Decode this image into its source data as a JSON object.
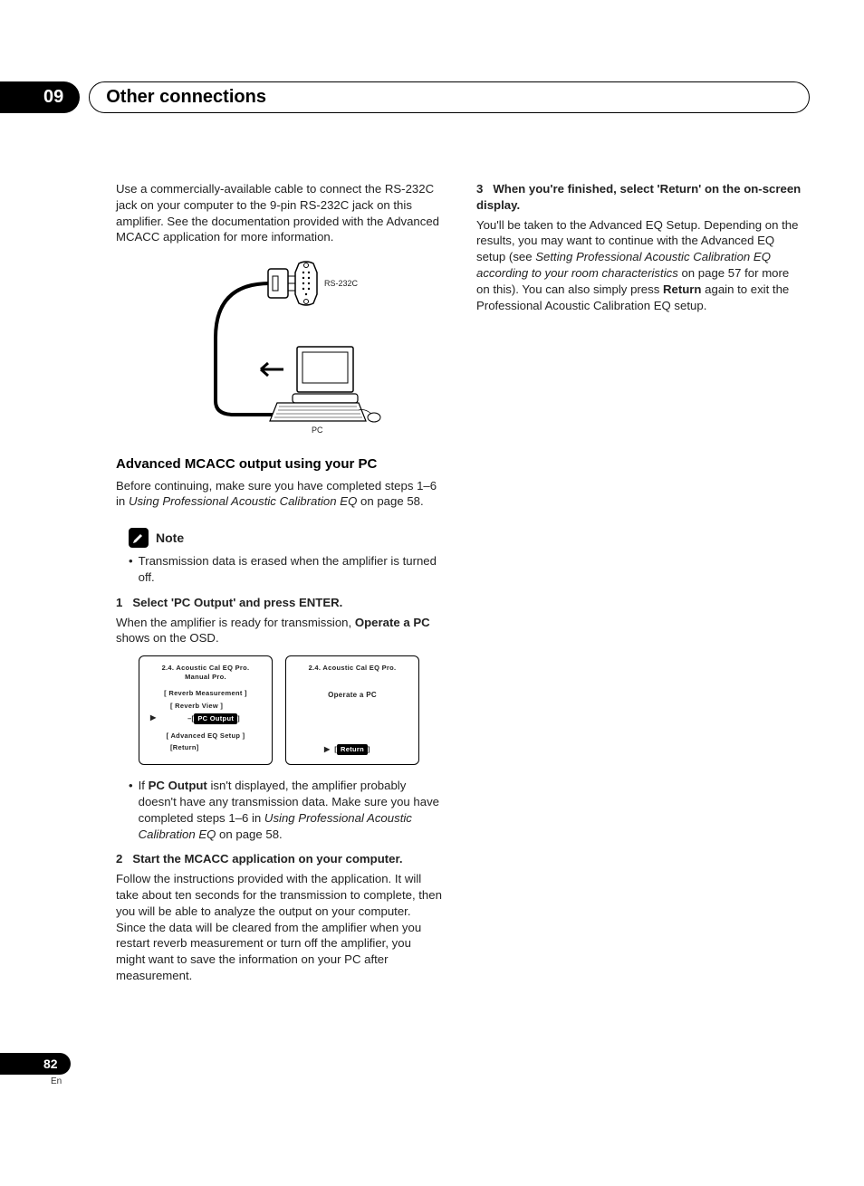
{
  "header": {
    "chapter_num": "09",
    "chapter_title": "Other connections"
  },
  "left": {
    "intro": "Use a commercially-available cable to connect the RS-232C jack on your computer to the 9-pin RS-232C jack on this amplifier. See the documentation provided with the Advanced MCACC application for more information.",
    "diagram": {
      "port_label": "RS-232C",
      "pc_label": "PC"
    },
    "subheading": "Advanced MCACC output using your PC",
    "sub_intro_a": "Before continuing, make sure you have completed steps 1–6 in ",
    "sub_intro_italic": "Using Professional Acoustic Calibration EQ",
    "sub_intro_b": " on page 58.",
    "note_label": "Note",
    "note_bullet": "Transmission data is erased when the amplifier is turned off.",
    "step1_num": "1",
    "step1_title": "Select 'PC Output' and press ENTER.",
    "step1_body_a": "When the amplifier is ready for transmission, ",
    "step1_body_bold": "Operate a PC",
    "step1_body_b": " shows on the OSD.",
    "osd1": {
      "title1": "2.4. Acoustic  Cal  EQ  Pro.",
      "title2": "Manual  Pro.",
      "l1": "[ Reverb  Measurement ]",
      "l2": "[ Reverb  View ]",
      "l3_prefix": "–[",
      "l3_sel": " PC  Output ",
      "l3_suffix": "]",
      "l4": "[ Advanced  EQ  Setup ]",
      "l5": "[Return]"
    },
    "osd2": {
      "title": "2.4. Acoustic  Cal  EQ  Pro.",
      "body": "Operate a PC",
      "ret_prefix": "[",
      "ret_sel": "Return",
      "ret_suffix": "]"
    },
    "after_osd_bullet_a": "If ",
    "after_osd_bullet_bold": "PC Output",
    "after_osd_bullet_b": " isn't displayed, the amplifier probably doesn't have any transmission data. Make sure you have completed steps 1–6 in ",
    "after_osd_bullet_italic": "Using Professional Acoustic Calibration EQ",
    "after_osd_bullet_c": " on page 58.",
    "step2_num": "2",
    "step2_title": "Start the MCACC application on your computer.",
    "step2_body": "Follow the instructions provided with the application. It will take about ten seconds for the transmission to complete, then you will be able to analyze the output on your computer. Since the data will be cleared from the amplifier when you restart reverb measurement or turn off the amplifier, you might want to save the information on your PC after measurement."
  },
  "right": {
    "step3_num": "3",
    "step3_title": "When you're finished, select 'Return' on the on-screen display.",
    "step3_body_a": "You'll be taken to the Advanced EQ Setup. Depending on the results, you may want to continue with the Advanced EQ setup (see ",
    "step3_body_italic": "Setting Professional Acoustic Calibration EQ according to your room characteristics",
    "step3_body_b": " on page 57 for more on this). You can also simply press ",
    "step3_body_bold": "Return",
    "step3_body_c": " again to exit the Professional Acoustic Calibration EQ setup."
  },
  "footer": {
    "page_num": "82",
    "lang": "En"
  }
}
